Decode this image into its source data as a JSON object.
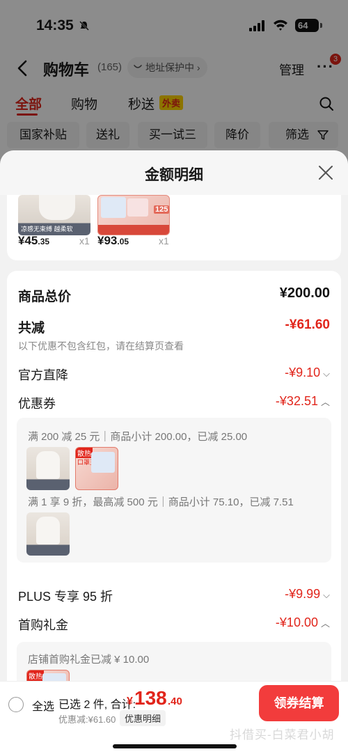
{
  "status_bar": {
    "time": "14:35",
    "battery": "64"
  },
  "nav": {
    "title": "购物车",
    "count": "(165)",
    "address": "地址保护中 ›",
    "manage": "管理",
    "more": "···",
    "badge": "3"
  },
  "tabs": [
    {
      "label": "全部"
    },
    {
      "label": "购物"
    },
    {
      "label": "秒送"
    }
  ],
  "tab_badge": "外卖",
  "filters": [
    "国家补贴",
    "送礼",
    "买一试三",
    "降价",
    "筛选"
  ],
  "sheet": {
    "title": "金额明细",
    "top_items": [
      {
        "thumb_caption": "凉感无束缚 越柔软",
        "price_int": "¥45",
        "price_dec": ".35",
        "qty": "x1"
      },
      {
        "thumb_caption": "125",
        "price_int": "¥93",
        "price_dec": ".05",
        "qty": "x1"
      }
    ],
    "total_label": "商品总价",
    "total_value": "¥200.00",
    "reduce_label": "共减",
    "reduce_value": "-¥61.60",
    "reduce_note": "以下优惠不包含红包，请在结算页查看",
    "official_label": "官方直降",
    "official_value": "-¥9.10",
    "coupon_label": "优惠券",
    "coupon_value": "-¥32.51",
    "coupon_line1": "满 200 减 25 元｜商品小计 200.00，已减 25.00",
    "coupon_line2": "满 1 享 9 折，最高减 500 元｜商品小计 75.10，已减 7.51",
    "thumb_tag_hot": "散热",
    "thumb_tag_sub": "口罩王",
    "plus_label": "PLUS 专享 95 折",
    "plus_value": "-¥9.99",
    "gift_label": "首购礼金",
    "gift_value": "-¥10.00",
    "gift_line": "店铺首购礼金已减 ¥ 10.00"
  },
  "bottom": {
    "select_all": "全选",
    "selected": "已选 2 件, 合计:",
    "total_symbol": "¥",
    "total_int": "138",
    "total_dec": ".40",
    "discount": "优惠减:¥61.60",
    "detail_chip": "优惠明细",
    "checkout": "领券结算",
    "watermark": "抖借买-白菜君小胡"
  }
}
